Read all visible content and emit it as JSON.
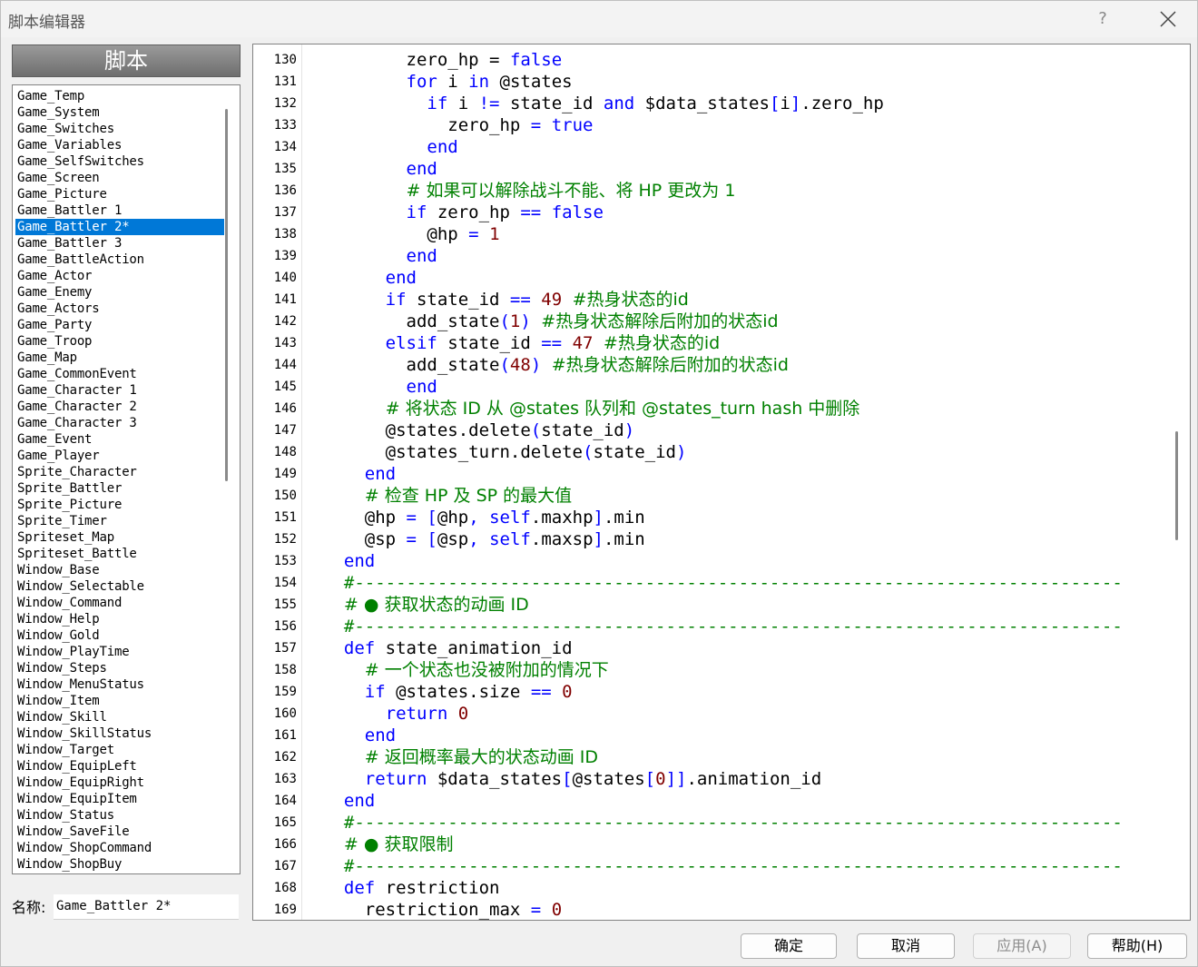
{
  "window": {
    "title": "脚本编辑器",
    "help_glyph": "?"
  },
  "sidebar": {
    "header": "脚本",
    "selected_index": 8,
    "items": [
      "Game_Temp",
      "Game_System",
      "Game_Switches",
      "Game_Variables",
      "Game_SelfSwitches",
      "Game_Screen",
      "Game_Picture",
      "Game_Battler 1",
      "Game_Battler 2*",
      "Game_Battler 3",
      "Game_BattleAction",
      "Game_Actor",
      "Game_Enemy",
      "Game_Actors",
      "Game_Party",
      "Game_Troop",
      "Game_Map",
      "Game_CommonEvent",
      "Game_Character 1",
      "Game_Character 2",
      "Game_Character 3",
      "Game_Event",
      "Game_Player",
      "Sprite_Character",
      "Sprite_Battler",
      "Sprite_Picture",
      "Sprite_Timer",
      "Spriteset_Map",
      "Spriteset_Battle",
      "Window_Base",
      "Window_Selectable",
      "Window_Command",
      "Window_Help",
      "Window_Gold",
      "Window_PlayTime",
      "Window_Steps",
      "Window_MenuStatus",
      "Window_Item",
      "Window_Skill",
      "Window_SkillStatus",
      "Window_Target",
      "Window_EquipLeft",
      "Window_EquipRight",
      "Window_EquipItem",
      "Window_Status",
      "Window_SaveFile",
      "Window_ShopCommand",
      "Window_ShopBuy"
    ],
    "name_label": "名称:",
    "name_value": "Game_Battler 2*"
  },
  "editor": {
    "lines": [
      {
        "n": "130",
        "t": [
          [
            "        zero_hp ",
            ""
          ],
          [
            "=",
            ""
          ],
          [
            " ",
            ""
          ],
          [
            "false",
            "k"
          ]
        ]
      },
      {
        "n": "131",
        "t": [
          [
            "        ",
            ""
          ],
          [
            "for",
            "k"
          ],
          [
            " i ",
            ""
          ],
          [
            "in",
            "k"
          ],
          [
            " @states",
            ""
          ]
        ]
      },
      {
        "n": "132",
        "t": [
          [
            "          ",
            ""
          ],
          [
            "if",
            "k"
          ],
          [
            " i ",
            ""
          ],
          [
            "!=",
            "o"
          ],
          [
            " state_id ",
            ""
          ],
          [
            "and",
            "k"
          ],
          [
            " $data_states",
            ""
          ],
          [
            "[",
            "o"
          ],
          [
            "i",
            ""
          ],
          [
            "]",
            "o"
          ],
          [
            ".zero_hp",
            ""
          ]
        ]
      },
      {
        "n": "133",
        "t": [
          [
            "            zero_hp ",
            ""
          ],
          [
            "=",
            "o"
          ],
          [
            " ",
            ""
          ],
          [
            "true",
            "k"
          ]
        ]
      },
      {
        "n": "134",
        "t": [
          [
            "          ",
            ""
          ],
          [
            "end",
            "k"
          ]
        ]
      },
      {
        "n": "135",
        "t": [
          [
            "        ",
            ""
          ],
          [
            "end",
            "k"
          ]
        ]
      },
      {
        "n": "136",
        "t": [
          [
            "        ",
            ""
          ],
          [
            "# 如果可以解除战斗不能、将 HP 更改为 1",
            "c"
          ]
        ]
      },
      {
        "n": "137",
        "t": [
          [
            "        ",
            ""
          ],
          [
            "if",
            "k"
          ],
          [
            " zero_hp ",
            ""
          ],
          [
            "==",
            "o"
          ],
          [
            " ",
            ""
          ],
          [
            "false",
            "k"
          ]
        ]
      },
      {
        "n": "138",
        "t": [
          [
            "          @hp ",
            ""
          ],
          [
            "=",
            "o"
          ],
          [
            " ",
            ""
          ],
          [
            "1",
            "n"
          ]
        ]
      },
      {
        "n": "139",
        "t": [
          [
            "        ",
            ""
          ],
          [
            "end",
            "k"
          ]
        ]
      },
      {
        "n": "140",
        "t": [
          [
            "      ",
            ""
          ],
          [
            "end",
            "k"
          ]
        ]
      },
      {
        "n": "141",
        "t": [
          [
            "      ",
            ""
          ],
          [
            "if",
            "k"
          ],
          [
            " state_id ",
            ""
          ],
          [
            "==",
            "o"
          ],
          [
            " ",
            ""
          ],
          [
            "49",
            "n"
          ],
          [
            " ",
            ""
          ],
          [
            "#热身状态的id",
            "c"
          ]
        ]
      },
      {
        "n": "142",
        "t": [
          [
            "        add_state",
            ""
          ],
          [
            "(",
            "o"
          ],
          [
            "1",
            "n"
          ],
          [
            ")",
            "o"
          ],
          [
            " ",
            ""
          ],
          [
            "#热身状态解除后附加的状态id",
            "c"
          ]
        ]
      },
      {
        "n": "143",
        "t": [
          [
            "      ",
            ""
          ],
          [
            "elsif",
            "k"
          ],
          [
            " state_id ",
            ""
          ],
          [
            "==",
            "o"
          ],
          [
            " ",
            ""
          ],
          [
            "47",
            "n"
          ],
          [
            " ",
            ""
          ],
          [
            "#热身状态的id",
            "c"
          ]
        ]
      },
      {
        "n": "144",
        "t": [
          [
            "        add_state",
            ""
          ],
          [
            "(",
            "o"
          ],
          [
            "48",
            "n"
          ],
          [
            ")",
            "o"
          ],
          [
            " ",
            ""
          ],
          [
            "#热身状态解除后附加的状态id",
            "c"
          ]
        ]
      },
      {
        "n": "145",
        "t": [
          [
            "        ",
            ""
          ],
          [
            "end",
            "k"
          ]
        ]
      },
      {
        "n": "146",
        "t": [
          [
            "      ",
            ""
          ],
          [
            "# 将状态 ID 从 @states 队列和 @states_turn hash 中删除",
            "c"
          ]
        ]
      },
      {
        "n": "147",
        "t": [
          [
            "      @states.delete",
            ""
          ],
          [
            "(",
            "o"
          ],
          [
            "state_id",
            ""
          ],
          [
            ")",
            "o"
          ]
        ]
      },
      {
        "n": "148",
        "t": [
          [
            "      @states_turn.delete",
            ""
          ],
          [
            "(",
            "o"
          ],
          [
            "state_id",
            ""
          ],
          [
            ")",
            "o"
          ]
        ]
      },
      {
        "n": "149",
        "t": [
          [
            "    ",
            ""
          ],
          [
            "end",
            "k"
          ]
        ]
      },
      {
        "n": "150",
        "t": [
          [
            "    ",
            ""
          ],
          [
            "# 检查 HP 及 SP 的最大值",
            "c"
          ]
        ]
      },
      {
        "n": "151",
        "t": [
          [
            "    @hp ",
            ""
          ],
          [
            "=",
            "o"
          ],
          [
            " ",
            ""
          ],
          [
            "[",
            "o"
          ],
          [
            "@hp",
            ""
          ],
          [
            ",",
            "o"
          ],
          [
            " ",
            ""
          ],
          [
            "self",
            "k"
          ],
          [
            ".maxhp",
            ""
          ],
          [
            "]",
            "o"
          ],
          [
            ".min",
            ""
          ]
        ]
      },
      {
        "n": "152",
        "t": [
          [
            "    @sp ",
            ""
          ],
          [
            "=",
            "o"
          ],
          [
            " ",
            ""
          ],
          [
            "[",
            "o"
          ],
          [
            "@sp",
            ""
          ],
          [
            ",",
            "o"
          ],
          [
            " ",
            ""
          ],
          [
            "self",
            "k"
          ],
          [
            ".maxsp",
            ""
          ],
          [
            "]",
            "o"
          ],
          [
            ".min",
            ""
          ]
        ]
      },
      {
        "n": "153",
        "t": [
          [
            "  ",
            ""
          ],
          [
            "end",
            "k"
          ]
        ]
      },
      {
        "n": "154",
        "t": [
          [
            "  ",
            ""
          ],
          [
            "#--------------------------------------------------------------------------",
            "c"
          ]
        ]
      },
      {
        "n": "155",
        "t": [
          [
            "  ",
            ""
          ],
          [
            "# ● 获取状态的动画 ID",
            "c"
          ]
        ]
      },
      {
        "n": "156",
        "t": [
          [
            "  ",
            ""
          ],
          [
            "#--------------------------------------------------------------------------",
            "c"
          ]
        ]
      },
      {
        "n": "157",
        "t": [
          [
            "  ",
            ""
          ],
          [
            "def",
            "k"
          ],
          [
            " state_animation_id",
            ""
          ]
        ]
      },
      {
        "n": "158",
        "t": [
          [
            "    ",
            ""
          ],
          [
            "# 一个状态也没被附加的情况下",
            "c"
          ]
        ]
      },
      {
        "n": "159",
        "t": [
          [
            "    ",
            ""
          ],
          [
            "if",
            "k"
          ],
          [
            " @states.size ",
            ""
          ],
          [
            "==",
            "o"
          ],
          [
            " ",
            ""
          ],
          [
            "0",
            "n"
          ]
        ]
      },
      {
        "n": "160",
        "t": [
          [
            "      ",
            ""
          ],
          [
            "return",
            "k"
          ],
          [
            " ",
            ""
          ],
          [
            "0",
            "n"
          ]
        ]
      },
      {
        "n": "161",
        "t": [
          [
            "    ",
            ""
          ],
          [
            "end",
            "k"
          ]
        ]
      },
      {
        "n": "162",
        "t": [
          [
            "    ",
            ""
          ],
          [
            "# 返回概率最大的状态动画 ID",
            "c"
          ]
        ]
      },
      {
        "n": "163",
        "t": [
          [
            "    ",
            ""
          ],
          [
            "return",
            "k"
          ],
          [
            " $data_states",
            ""
          ],
          [
            "[",
            "o"
          ],
          [
            "@states",
            ""
          ],
          [
            "[",
            "o"
          ],
          [
            "0",
            "n"
          ],
          [
            "]]",
            "o"
          ],
          [
            ".animation_id",
            ""
          ]
        ]
      },
      {
        "n": "164",
        "t": [
          [
            "  ",
            ""
          ],
          [
            "end",
            "k"
          ]
        ]
      },
      {
        "n": "165",
        "t": [
          [
            "  ",
            ""
          ],
          [
            "#--------------------------------------------------------------------------",
            "c"
          ]
        ]
      },
      {
        "n": "166",
        "t": [
          [
            "  ",
            ""
          ],
          [
            "# ● 获取限制",
            "c"
          ]
        ]
      },
      {
        "n": "167",
        "t": [
          [
            "  ",
            ""
          ],
          [
            "#--------------------------------------------------------------------------",
            "c"
          ]
        ]
      },
      {
        "n": "168",
        "t": [
          [
            "  ",
            ""
          ],
          [
            "def",
            "k"
          ],
          [
            " restriction",
            ""
          ]
        ]
      },
      {
        "n": "169",
        "t": [
          [
            "    restriction_max ",
            ""
          ],
          [
            "=",
            "o"
          ],
          [
            " ",
            ""
          ],
          [
            "0",
            "n"
          ]
        ]
      }
    ]
  },
  "buttons": {
    "ok": "确定",
    "cancel": "取消",
    "apply": "应用(A)",
    "help": "帮助(H)"
  },
  "colors": {
    "keyword": "#0000ff",
    "number": "#800000",
    "comment": "#008000",
    "selection": "#0078d7"
  }
}
